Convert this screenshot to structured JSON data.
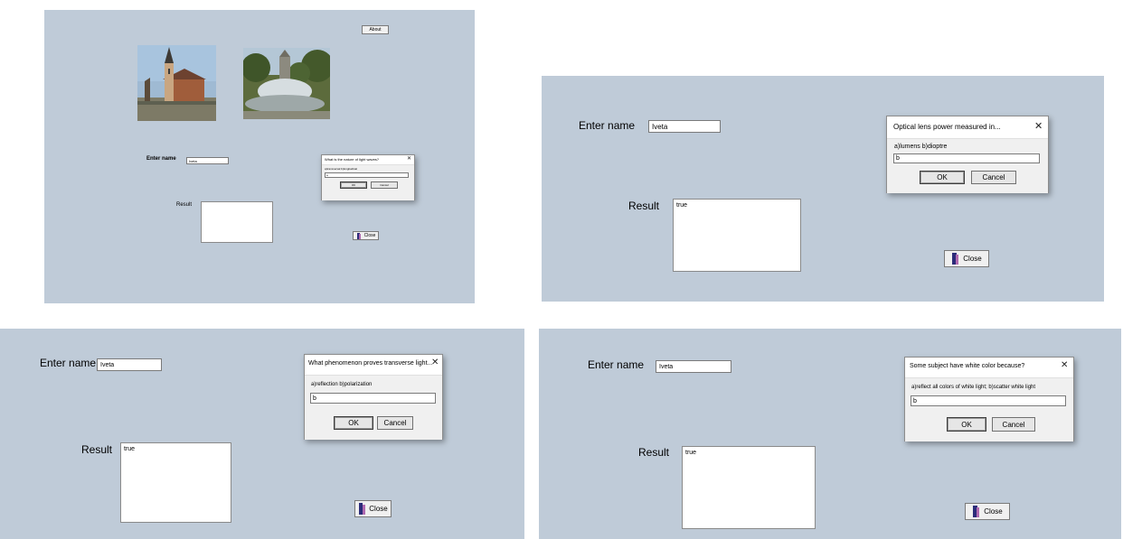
{
  "panels": [
    {
      "name_label": "Enter name",
      "name_value": "Iveta",
      "result_label": "Result",
      "result_value": "",
      "close_label": "Close",
      "about_label": "About",
      "dialog": {
        "title": "What is the nature of light waves?",
        "options": "a)transversal b)longitudinal",
        "input": "a",
        "ok": "OK",
        "cancel": "Cancel"
      }
    },
    {
      "name_label": "Enter name",
      "name_value": "Iveta",
      "result_label": "Result",
      "result_value": "true",
      "close_label": "Close",
      "dialog": {
        "title": "Optical lens power measured in...",
        "options": "a)lumens b)dioptre",
        "input": "b",
        "ok": "OK",
        "cancel": "Cancel"
      }
    },
    {
      "name_label": "Enter name",
      "name_value": "Iveta",
      "result_label": "Result",
      "result_value": "true",
      "close_label": "Close",
      "dialog": {
        "title": "What phenomenon proves transverse light...",
        "options": "a)reflection b)polarization",
        "input": "b",
        "ok": "OK",
        "cancel": "Cancel"
      }
    },
    {
      "name_label": "Enter name",
      "name_value": "Iveta",
      "result_label": "Result",
      "result_value": "true",
      "close_label": "Close",
      "dialog": {
        "title": "Some subject have white color because?",
        "options": "a)reflect all colors of white light; b)scatter white light",
        "input": "b",
        "ok": "OK",
        "cancel": "Cancel"
      }
    }
  ],
  "icons": {
    "dialog_close": "close-x-icon",
    "exit": "exit-door-icon"
  },
  "colors": {
    "form_background": "#bfcbd8",
    "dialog_body": "#f0f0f0"
  }
}
